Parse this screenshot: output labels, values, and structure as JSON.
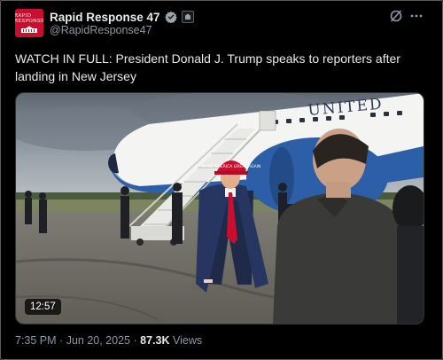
{
  "account": {
    "display_name": "Rapid Response 47",
    "handle": "@RapidResponse47",
    "avatar_text": "RAPID RESPONSE",
    "verified_icon": "verified-check-icon",
    "badge_icon": "government-badge-icon"
  },
  "header_actions": {
    "grok_icon": "grok-icon",
    "more_icon": "more-options-icon"
  },
  "post": {
    "text": "WATCH IN FULL: President Donald J. Trump speaks to reporters after landing in New Jersey",
    "video_duration": "12:57",
    "plane_lettering": "UNITED",
    "hat_text": "MAKE AMERICA GREAT AGAIN"
  },
  "meta": {
    "time": "7:35 PM",
    "separator": "·",
    "date": "Jun 20, 2025",
    "views_count": "87.3K",
    "views_label": "Views"
  },
  "colors": {
    "background": "#000000",
    "text_primary": "#e7e9ea",
    "text_secondary": "#8b98a5",
    "verified_blue": "#1d9bf0",
    "avatar_red": "#c8102e"
  }
}
